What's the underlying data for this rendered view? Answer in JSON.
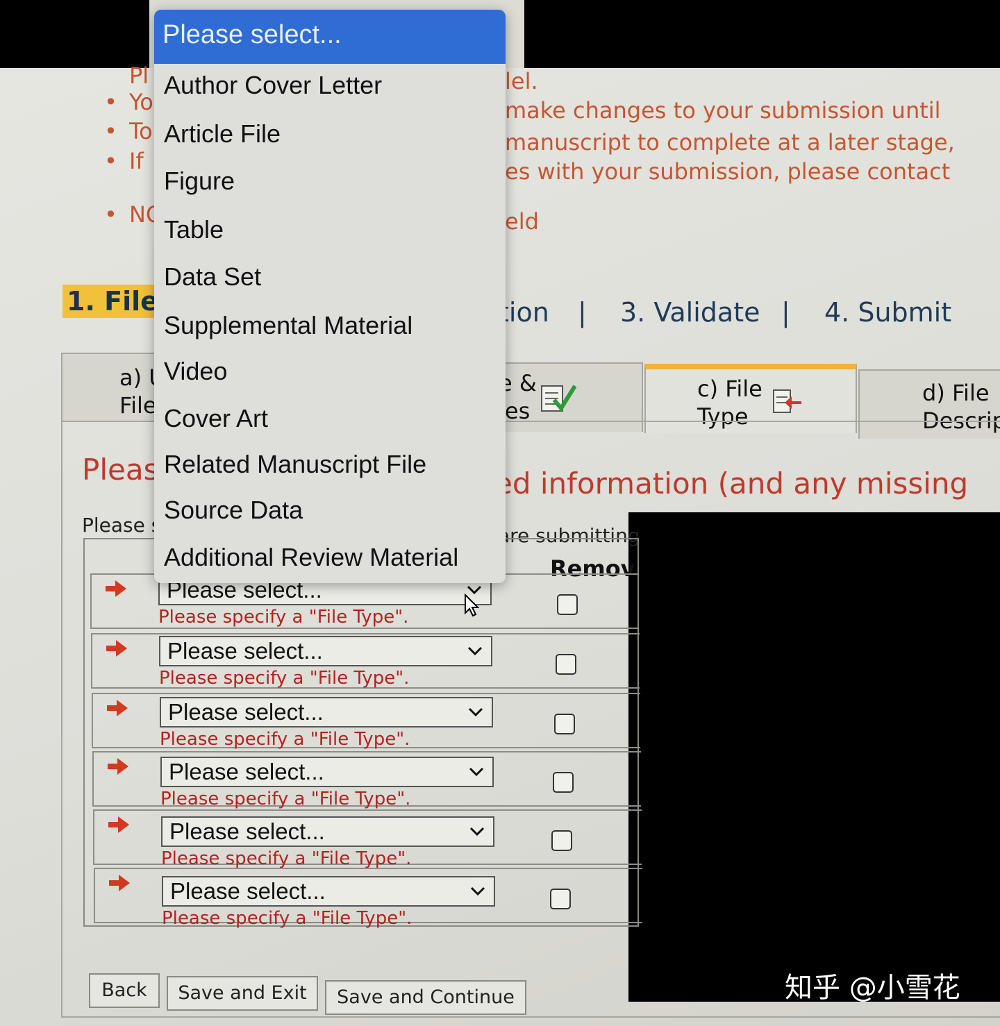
{
  "bullets": [
    {
      "left": "Pl",
      "right": "lel."
    },
    {
      "left": "Yo",
      "right": "make changes to your submission until"
    },
    {
      "left": "To",
      "right": "manuscript to complete at a later stage,"
    },
    {
      "left": "If",
      "right": "es with your submission, please contact"
    },
    {
      "left": "NC",
      "right": "eld"
    }
  ],
  "steps": {
    "active": "1. Files",
    "step2_fragment": "tion",
    "step3": "3. Validate",
    "step4": "4. Submit",
    "separator": "|"
  },
  "tabs": [
    {
      "label": "a) U\nFile"
    },
    {
      "label": "e &\nles"
    },
    {
      "label": "c) File\nType"
    },
    {
      "label": "d) File\nDescrip"
    }
  ],
  "heading": {
    "left": "Pleas",
    "right": "ed information (and any missing"
  },
  "subtext": {
    "left": "Please s",
    "right": "are submitting"
  },
  "column_remove": "Remov",
  "rows": [
    {
      "select": "Please select...",
      "warning": "Please specify a \"File Type\"."
    },
    {
      "select": "Please select...",
      "warning": "Please specify a \"File Type\"."
    },
    {
      "select": "Please select...",
      "warning": "Please specify a \"File Type\"."
    },
    {
      "select": "Please select...",
      "warning": "Please specify a \"File Type\"."
    },
    {
      "select": "Please select...",
      "warning": "Please specify a \"File Type\"."
    },
    {
      "select": "Please select...",
      "warning": "Please specify a \"File Type\"."
    }
  ],
  "buttons": {
    "back": "Back",
    "save_exit": "Save and Exit",
    "save_continue": "Save and Continue"
  },
  "dropdown": {
    "selected": "Please select...",
    "options": [
      "Author Cover Letter",
      "Article File",
      "Figure",
      "Table",
      "Data Set",
      "Supplemental Material",
      "Video",
      "Cover Art",
      "Related Manuscript File",
      "Source Data",
      "Additional Review Material"
    ]
  },
  "watermark": "知乎 @小雪花",
  "colors": {
    "accent": "#2f6cd4",
    "warning": "#b3231f",
    "step_highlight": "#f2c13a",
    "bullet_text": "#c8552f"
  }
}
